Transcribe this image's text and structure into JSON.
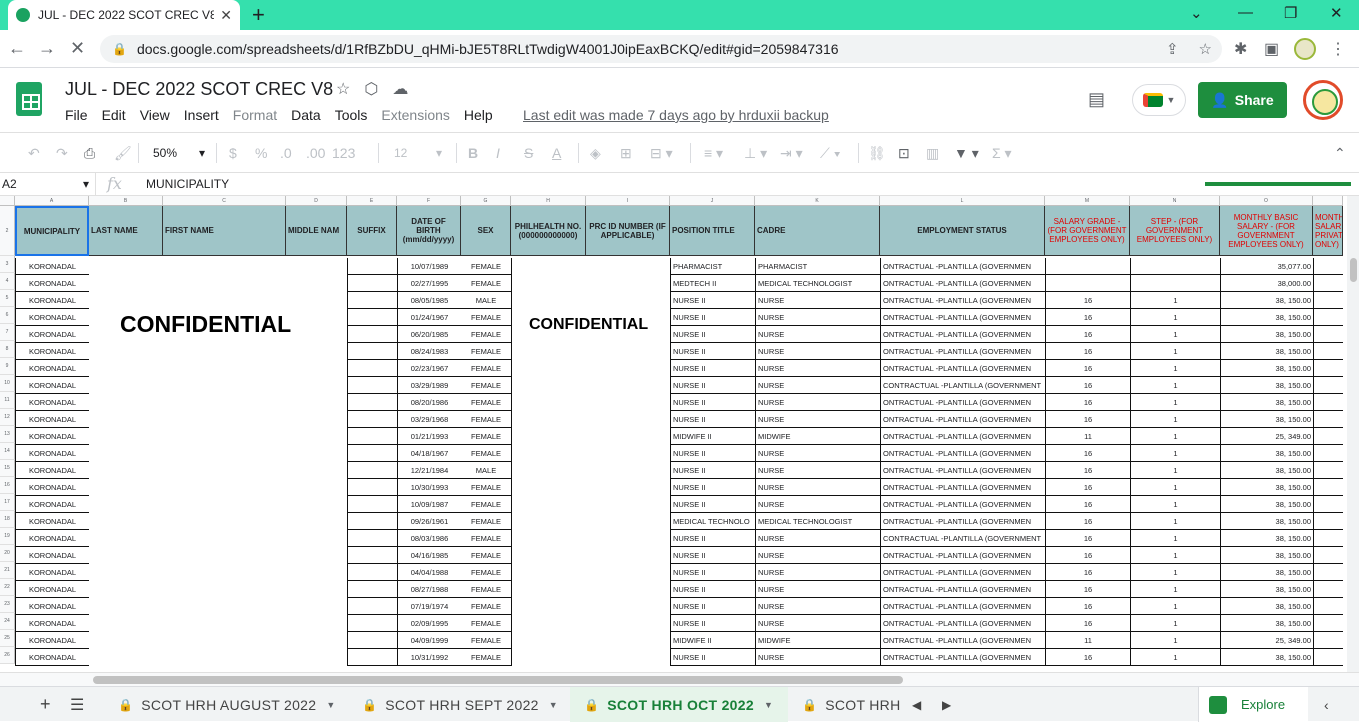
{
  "browser": {
    "tab_title": "JUL - DEC 2022 SCOT CREC V8 - ",
    "url": "docs.google.com/spreadsheets/d/1RfBZbDU_qHMi-bJE5T8RLtTwdigW4001J0ipEaxBCKQ/edit#gid=2059847316"
  },
  "app": {
    "doc_title": "JUL - DEC 2022 SCOT CREC V8",
    "menu": [
      "File",
      "Edit",
      "View",
      "Insert",
      "Format",
      "Data",
      "Tools",
      "Extensions",
      "Help"
    ],
    "menu_disabled": [
      "Format",
      "Extensions"
    ],
    "last_edit": "Last edit was made 7 days ago by hrduxii backup",
    "share_label": "Share",
    "accent": "#1e8e3e"
  },
  "toolbar": {
    "zoom": "50%",
    "currency": "$",
    "percent": "%",
    "dec_less": ".0",
    "dec_more": ".00",
    "number_format": "123",
    "font_size": "12",
    "bold": "B",
    "italic": "I",
    "strike": "S",
    "text_color": "A"
  },
  "formula_bar": {
    "cell_ref": "A2",
    "fx": "fx",
    "value": "MUNICIPALITY"
  },
  "grid": {
    "col_letters": [
      "A",
      "B",
      "C",
      "D",
      "E",
      "F",
      "G",
      "H",
      "I",
      "J",
      "K",
      "L",
      "M",
      "N",
      "O",
      ""
    ],
    "headers": [
      "MUNICIPALITY",
      "LAST NAME",
      "FIRST NAME",
      "MIDDLE NAM",
      "SUFFIX",
      "DATE OF BIRTH (mm/dd/yyyy)",
      "SEX",
      "PHILHEALTH NO. (000000000000)",
      "PRC ID NUMBER (IF APPLICABLE)",
      "POSITION TITLE",
      "CADRE",
      "EMPLOYMENT STATUS",
      "SALARY GRADE - (FOR GOVERNMENT EMPLOYEES ONLY)",
      "STEP - (FOR GOVERNMENT EMPLOYEES ONLY)",
      "MONTHLY BASIC SALARY - (FOR GOVERNMENT EMPLOYEES ONLY)",
      "MONTH SALAR PRIVAT ONLY)"
    ],
    "row_numbers": [
      "2",
      "3",
      "4",
      "5",
      "6",
      "7",
      "8",
      "9",
      "10",
      "11",
      "12",
      "13",
      "14",
      "15",
      "16",
      "17",
      "18",
      "19",
      "20",
      "21",
      "22",
      "23",
      "24",
      "25",
      "26"
    ],
    "rows": [
      {
        "mun": "KORONADAL",
        "dob": "10/07/1989",
        "sex": "FEMALE",
        "pos": "PHARMACIST",
        "cadre": "PHARMACIST",
        "status": "ONTRACTUAL -PLANTILLA (GOVERNMEN",
        "sg": "",
        "step": "",
        "salary": "35,077.00"
      },
      {
        "mun": "KORONADAL",
        "dob": "02/27/1995",
        "sex": "FEMALE",
        "pos": "MEDTECH II",
        "cadre": "MEDICAL TECHNOLOGIST",
        "status": "ONTRACTUAL -PLANTILLA (GOVERNMEN",
        "sg": "",
        "step": "",
        "salary": "38,000.00"
      },
      {
        "mun": "KORONADAL",
        "dob": "08/05/1985",
        "sex": "MALE",
        "pos": "NURSE II",
        "cadre": "NURSE",
        "status": "ONTRACTUAL -PLANTILLA (GOVERNMEN",
        "sg": "16",
        "step": "1",
        "salary": "38, 150.00"
      },
      {
        "mun": "KORONADAL",
        "dob": "01/24/1967",
        "sex": "FEMALE",
        "pos": "NURSE II",
        "cadre": "NURSE",
        "status": "ONTRACTUAL -PLANTILLA (GOVERNMEN",
        "sg": "16",
        "step": "1",
        "salary": "38, 150.00"
      },
      {
        "mun": "KORONADAL",
        "dob": "06/20/1985",
        "sex": "FEMALE",
        "pos": "NURSE II",
        "cadre": "NURSE",
        "status": "ONTRACTUAL -PLANTILLA (GOVERNMEN",
        "sg": "16",
        "step": "1",
        "salary": "38, 150.00"
      },
      {
        "mun": "KORONADAL",
        "dob": "08/24/1983",
        "sex": "FEMALE",
        "pos": "NURSE II",
        "cadre": "NURSE",
        "status": "ONTRACTUAL -PLANTILLA (GOVERNMEN",
        "sg": "16",
        "step": "1",
        "salary": "38, 150.00"
      },
      {
        "mun": "KORONADAL",
        "dob": "02/23/1967",
        "sex": "FEMALE",
        "pos": "NURSE II",
        "cadre": "NURSE",
        "status": "ONTRACTUAL -PLANTILLA (GOVERNMEN",
        "sg": "16",
        "step": "1",
        "salary": "38, 150.00"
      },
      {
        "mun": "KORONADAL",
        "dob": "03/29/1989",
        "sex": "FEMALE",
        "pos": "NURSE II",
        "cadre": "NURSE",
        "status": "CONTRACTUAL -PLANTILLA (GOVERNMENT",
        "sg": "16",
        "step": "1",
        "salary": "38, 150.00"
      },
      {
        "mun": "KORONADAL",
        "dob": "08/20/1986",
        "sex": "FEMALE",
        "pos": "NURSE II",
        "cadre": "NURSE",
        "status": "ONTRACTUAL -PLANTILLA (GOVERNMEN",
        "sg": "16",
        "step": "1",
        "salary": "38, 150.00"
      },
      {
        "mun": "KORONADAL",
        "dob": "03/29/1968",
        "sex": "FEMALE",
        "pos": "NURSE II",
        "cadre": "NURSE",
        "status": "ONTRACTUAL -PLANTILLA (GOVERNMEN",
        "sg": "16",
        "step": "1",
        "salary": "38, 150.00"
      },
      {
        "mun": "KORONADAL",
        "dob": "01/21/1993",
        "sex": "FEMALE",
        "pos": "MIDWIFE II",
        "cadre": "MIDWIFE",
        "status": "ONTRACTUAL -PLANTILLA (GOVERNMEN",
        "sg": "11",
        "step": "1",
        "salary": "25, 349.00"
      },
      {
        "mun": "KORONADAL",
        "dob": "04/18/1967",
        "sex": "FEMALE",
        "pos": "NURSE II",
        "cadre": "NURSE",
        "status": "ONTRACTUAL -PLANTILLA (GOVERNMEN",
        "sg": "16",
        "step": "1",
        "salary": "38, 150.00"
      },
      {
        "mun": "KORONADAL",
        "dob": "12/21/1984",
        "sex": "MALE",
        "pos": "NURSE II",
        "cadre": "NURSE",
        "status": "ONTRACTUAL -PLANTILLA (GOVERNMEN",
        "sg": "16",
        "step": "1",
        "salary": "38, 150.00"
      },
      {
        "mun": "KORONADAL",
        "dob": "10/30/1993",
        "sex": "FEMALE",
        "pos": "NURSE II",
        "cadre": "NURSE",
        "status": "ONTRACTUAL -PLANTILLA (GOVERNMEN",
        "sg": "16",
        "step": "1",
        "salary": "38, 150.00"
      },
      {
        "mun": "KORONADAL",
        "dob": "10/09/1987",
        "sex": "FEMALE",
        "pos": "NURSE II",
        "cadre": "NURSE",
        "status": "ONTRACTUAL -PLANTILLA (GOVERNMEN",
        "sg": "16",
        "step": "1",
        "salary": "38, 150.00"
      },
      {
        "mun": "KORONADAL",
        "dob": "09/26/1961",
        "sex": "FEMALE",
        "pos": "MEDICAL TECHNOLO",
        "cadre": "MEDICAL TECHNOLOGIST",
        "status": "ONTRACTUAL -PLANTILLA (GOVERNMEN",
        "sg": "16",
        "step": "1",
        "salary": "38, 150.00"
      },
      {
        "mun": "KORONADAL",
        "dob": "08/03/1986",
        "sex": "FEMALE",
        "pos": "NURSE II",
        "cadre": "NURSE",
        "status": "CONTRACTUAL -PLANTILLA (GOVERNMENT",
        "sg": "16",
        "step": "1",
        "salary": "38, 150.00"
      },
      {
        "mun": "KORONADAL",
        "dob": "04/16/1985",
        "sex": "FEMALE",
        "pos": "NURSE II",
        "cadre": "NURSE",
        "status": "ONTRACTUAL -PLANTILLA (GOVERNMEN",
        "sg": "16",
        "step": "1",
        "salary": "38, 150.00"
      },
      {
        "mun": "KORONADAL",
        "dob": "04/04/1988",
        "sex": "FEMALE",
        "pos": "NURSE II",
        "cadre": "NURSE",
        "status": "ONTRACTUAL -PLANTILLA (GOVERNMEN",
        "sg": "16",
        "step": "1",
        "salary": "38, 150.00"
      },
      {
        "mun": "KORONADAL",
        "dob": "08/27/1988",
        "sex": "FEMALE",
        "pos": "NURSE II",
        "cadre": "NURSE",
        "status": "ONTRACTUAL -PLANTILLA (GOVERNMEN",
        "sg": "16",
        "step": "1",
        "salary": "38, 150.00"
      },
      {
        "mun": "KORONADAL",
        "dob": "07/19/1974",
        "sex": "FEMALE",
        "pos": "NURSE II",
        "cadre": "NURSE",
        "status": "ONTRACTUAL -PLANTILLA (GOVERNMEN",
        "sg": "16",
        "step": "1",
        "salary": "38, 150.00"
      },
      {
        "mun": "KORONADAL",
        "dob": "02/09/1995",
        "sex": "FEMALE",
        "pos": "NURSE II",
        "cadre": "NURSE",
        "status": "ONTRACTUAL -PLANTILLA (GOVERNMEN",
        "sg": "16",
        "step": "1",
        "salary": "38, 150.00"
      },
      {
        "mun": "KORONADAL",
        "dob": "04/09/1999",
        "sex": "FEMALE",
        "pos": "MIDWIFE II",
        "cadre": "MIDWIFE",
        "status": "ONTRACTUAL -PLANTILLA (GOVERNMEN",
        "sg": "11",
        "step": "1",
        "salary": "25, 349.00"
      },
      {
        "mun": "KORONADAL",
        "dob": "10/31/1992",
        "sex": "FEMALE",
        "pos": "NURSE II",
        "cadre": "NURSE",
        "status": "ONTRACTUAL -PLANTILLA (GOVERNMEN",
        "sg": "16",
        "step": "1",
        "salary": "38, 150.00"
      }
    ],
    "confidential_1": "CONFIDENTIAL",
    "confidential_2": "CONFIDENTIAL",
    "header_fill": "#9fc5c8",
    "red_header": "#e00000"
  },
  "sheet_tabs": [
    {
      "label": "SCOT HRH AUGUST 2022",
      "active": false
    },
    {
      "label": "SCOT HRH SEPT 2022",
      "active": false
    },
    {
      "label": "SCOT HRH OCT 2022",
      "active": true
    },
    {
      "label": "SCOT HRH",
      "active": false
    }
  ],
  "explore_label": "Explore"
}
